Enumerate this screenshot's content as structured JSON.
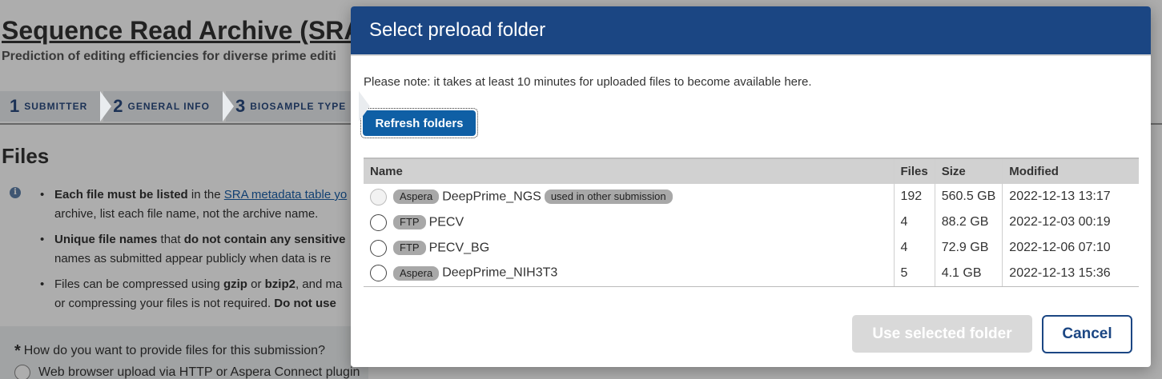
{
  "page": {
    "title": "Sequence Read Archive (SRA)",
    "subtitle": "Prediction of editing efficiencies for diverse prime editi",
    "steps": [
      {
        "num": "1",
        "label": "SUBMITTER"
      },
      {
        "num": "2",
        "label": "GENERAL INFO"
      },
      {
        "num": "3",
        "label": "BIOSAMPLE TYPE"
      }
    ],
    "files_heading": "Files",
    "info_icon": "info-icon",
    "bullets": {
      "b1_bold": "Each file must be listed",
      "b1_text": " in the ",
      "b1_link": "SRA metadata table yo",
      "b1_line2": "archive, list each file name, not the archive name.",
      "b2_bold": "Unique file names",
      "b2_text": " that ",
      "b2_bold2": "do not contain any sensitive",
      "b2_line2": "names as submitted appear publicly when data is re",
      "b3_text": "Files can be compressed using ",
      "b3_bold1": "gzip",
      "b3_or": " or ",
      "b3_bold2": "bzip2",
      "b3_text2": ", and ma",
      "b3_line2a": "or compressing your files is not required. ",
      "b3_line2b": "Do not use"
    },
    "question": "How do you want to provide files for this submission?",
    "question_star": "*",
    "radio_option": "Web browser upload via HTTP or Aspera Connect plugin"
  },
  "modal": {
    "title": "Select preload folder",
    "note": "Please note: it takes at least 10 minutes for uploaded files to become available here.",
    "refresh_label": "Refresh folders",
    "table": {
      "headers": {
        "name": "Name",
        "files": "Files",
        "size": "Size",
        "modified": "Modified"
      },
      "rows": [
        {
          "protocol": "Aspera",
          "name": "DeepPrime_NGS",
          "tag": "used in other submission",
          "files": "192",
          "size": "560.5 GB",
          "modified": "2022-12-13 13:17"
        },
        {
          "protocol": "FTP",
          "name": "PECV",
          "files": "4",
          "size": "88.2 GB",
          "modified": "2022-12-03 00:19"
        },
        {
          "protocol": "FTP",
          "name": "PECV_BG",
          "files": "4",
          "size": "72.9 GB",
          "modified": "2022-12-06 07:10"
        },
        {
          "protocol": "Aspera",
          "name": "DeepPrime_NIH3T3",
          "files": "5",
          "size": "4.1 GB",
          "modified": "2022-12-13 15:36"
        }
      ]
    },
    "use_label": "Use selected folder",
    "cancel_label": "Cancel"
  },
  "colors": {
    "modal_header": "#1b4683",
    "primary_button": "#0f5fa5",
    "badge": "#a8a8a8",
    "disabled_button": "#d9d9d9"
  }
}
